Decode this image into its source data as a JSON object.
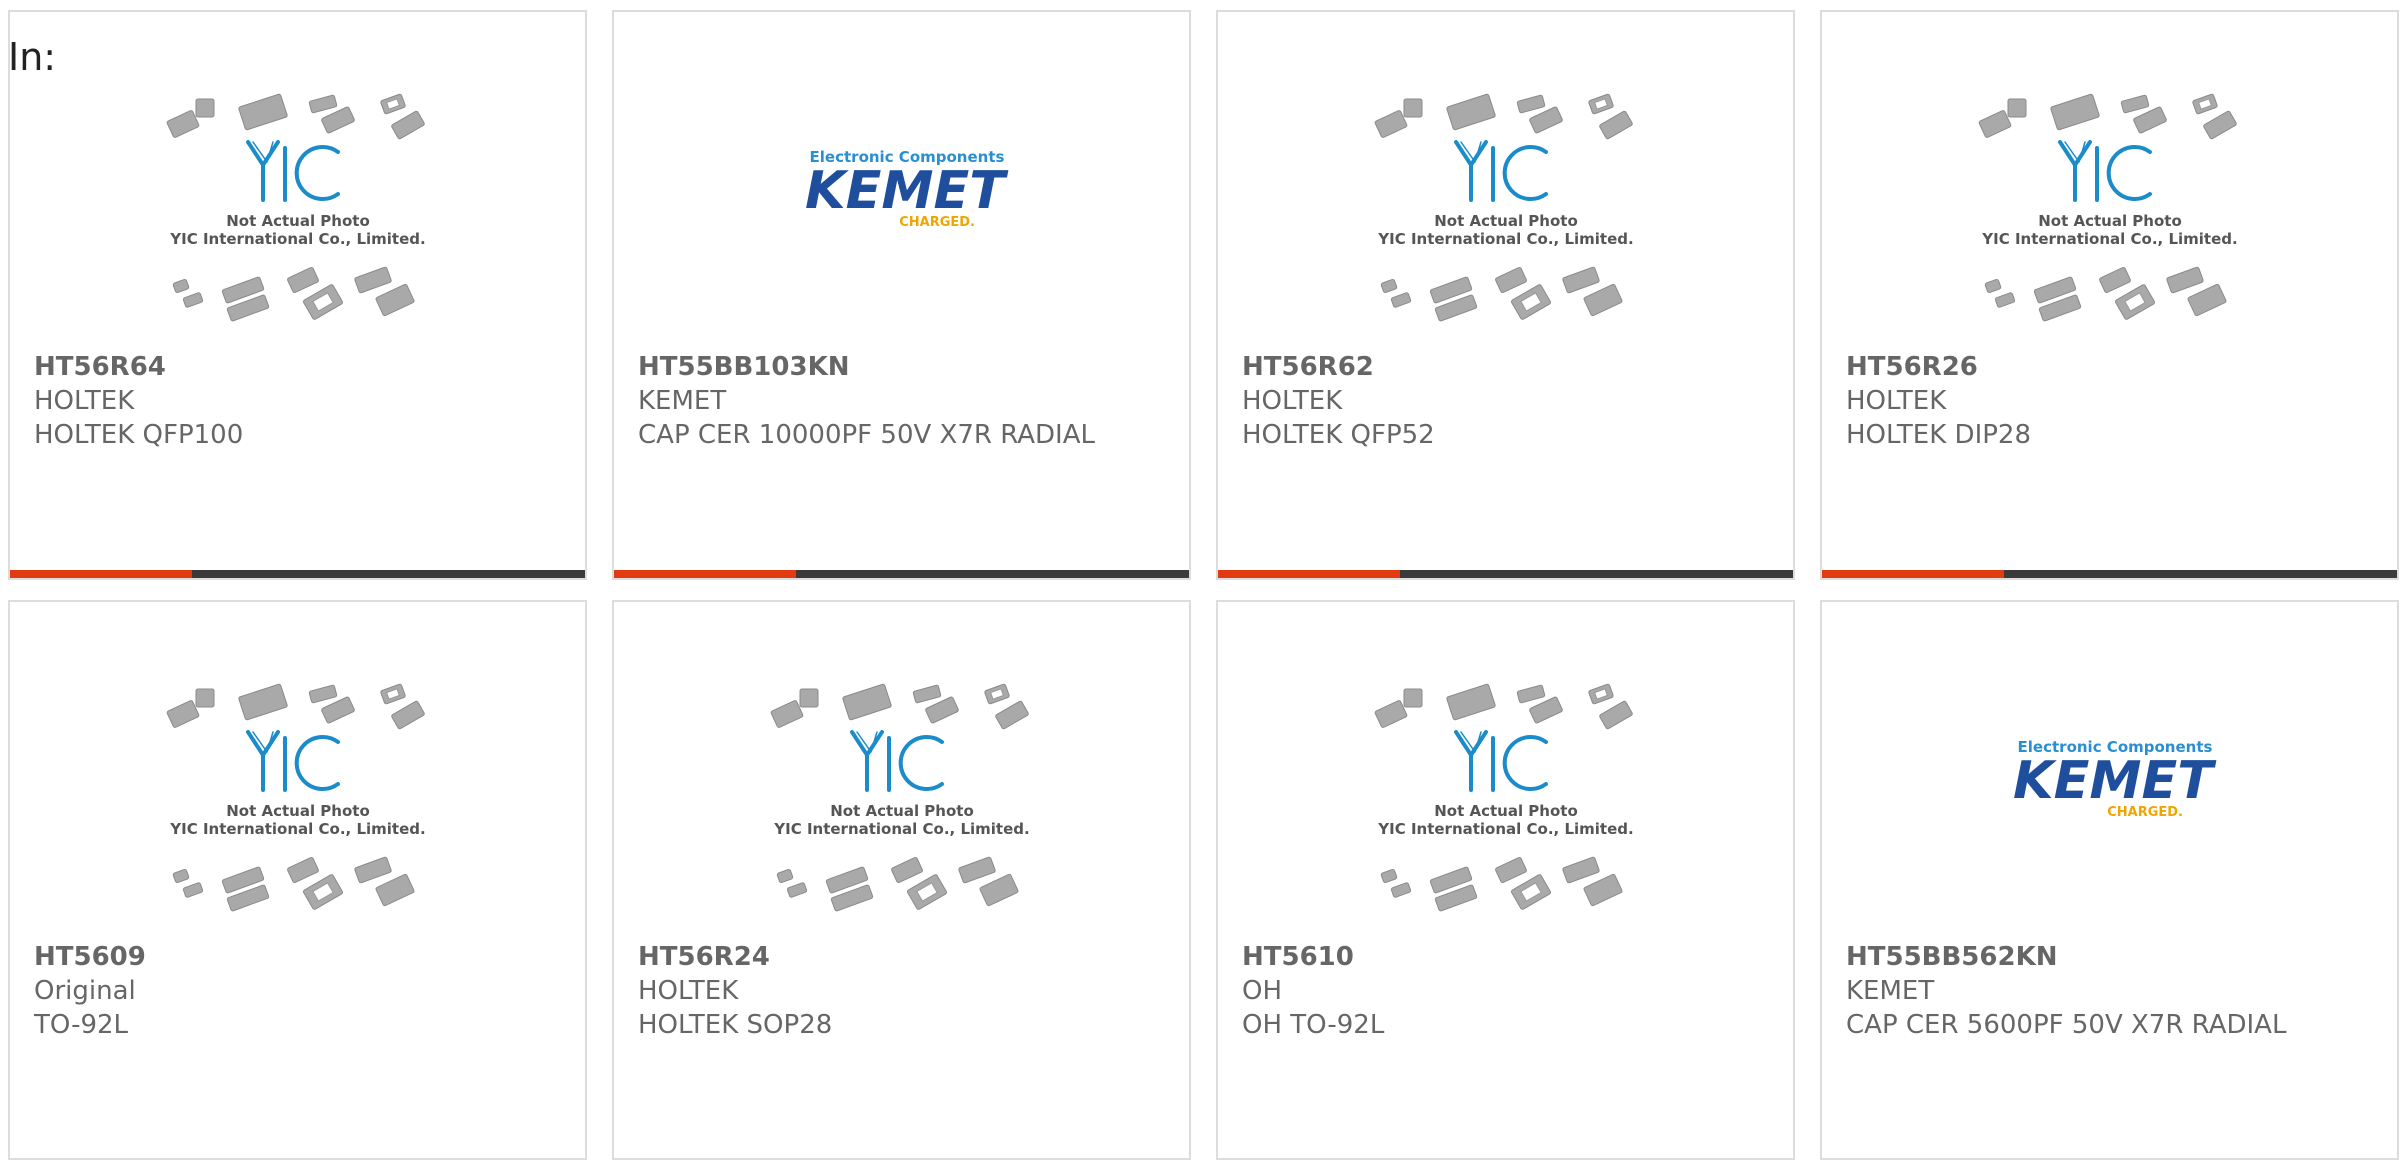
{
  "heading": "In:",
  "colors": {
    "accent": "#e23b12",
    "bar": "#3a3a3a",
    "text": "#666666",
    "yic_blue": "#1b8cc9",
    "kemet_blue": "#1f4f9c",
    "kemet_yellow": "#f0a500"
  },
  "products": [
    {
      "part": "HT56R64",
      "brand": "HOLTEK",
      "desc": "HOLTEK QFP100",
      "image": "yic"
    },
    {
      "part": "HT55BB103KN",
      "brand": "KEMET",
      "desc": "CAP CER 10000PF 50V X7R RADIAL",
      "image": "kemet"
    },
    {
      "part": "HT56R62",
      "brand": "HOLTEK",
      "desc": "HOLTEK QFP52",
      "image": "yic"
    },
    {
      "part": "HT56R26",
      "brand": "HOLTEK",
      "desc": "HOLTEK DIP28",
      "image": "yic"
    },
    {
      "part": "HT5609",
      "brand": "Original",
      "desc": "TO-92L",
      "image": "yic"
    },
    {
      "part": "HT56R24",
      "brand": "HOLTEK",
      "desc": "HOLTEK SOP28",
      "image": "yic"
    },
    {
      "part": "HT5610",
      "brand": "OH",
      "desc": "OH TO-92L",
      "image": "yic"
    },
    {
      "part": "HT55BB562KN",
      "brand": "KEMET",
      "desc": "CAP CER 5600PF 50V X7R RADIAL",
      "image": "kemet"
    }
  ],
  "placeholders": {
    "yic": {
      "line1": "Not Actual Photo",
      "line2": "YIC International Co., Limited."
    },
    "kemet": {
      "tagline": "Electronic Components",
      "name": "KEMET",
      "sub": "CHARGED."
    }
  }
}
